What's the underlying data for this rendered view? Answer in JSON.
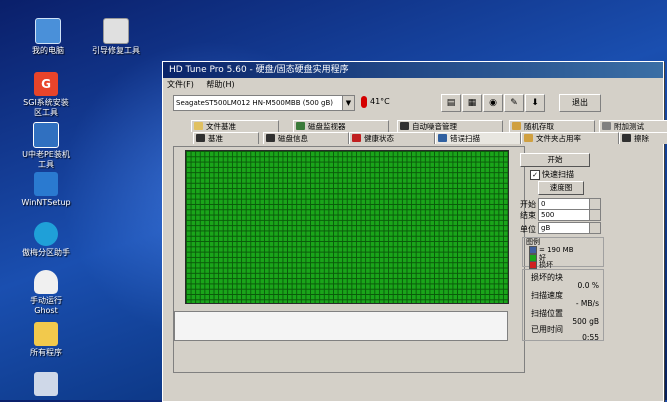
{
  "desktop": {
    "icons": [
      {
        "label": "我的电脑",
        "color": "#4a90d9"
      },
      {
        "label": "引导修复工具",
        "color": "#e0e0e0"
      },
      {
        "label": "SGI系统安装\n区工具",
        "color": "#e8442a"
      },
      {
        "label": "U中老PE装机\n工具",
        "color": "#3070c0"
      },
      {
        "label": "WinNTSetup",
        "color": "#2a7ad0"
      },
      {
        "label": "傲梅分区助手",
        "color": "#1fa0d8"
      },
      {
        "label": "手动运行\nGhost",
        "color": "#f0f0f0"
      },
      {
        "label": "所有程序",
        "color": "#f2c94c"
      }
    ]
  },
  "window": {
    "title": "HD Tune Pro 5.60 - 硬盘/固态硬盘实用程序",
    "menu": [
      "文件(F)",
      "帮助(H)"
    ],
    "drive": "SeagateST500LM012 HN-M500MBB (500 gB)",
    "temperature": "41°C",
    "exit_label": "退出",
    "tabs_row1": [
      {
        "label": "文件基准",
        "icon_color": "#e0c060"
      },
      {
        "label": "磁盘监视器",
        "icon_color": "#3a7a3a"
      },
      {
        "label": "自动噪音管理",
        "icon_color": "#303030"
      },
      {
        "label": "随机存取",
        "icon_color": "#d0a040"
      },
      {
        "label": "附加测试",
        "icon_color": "#808080"
      }
    ],
    "tabs_row2": [
      {
        "label": "基准",
        "icon_color": "#303030"
      },
      {
        "label": "磁盘信息",
        "icon_color": "#303030"
      },
      {
        "label": "健康状态",
        "icon_color": "#c02020"
      },
      {
        "label": "错误扫描",
        "icon_color": "#3060a0"
      },
      {
        "label": "文件夹占用率",
        "icon_color": "#d0a040"
      },
      {
        "label": "擦除",
        "icon_color": "#303030"
      }
    ]
  },
  "scan": {
    "start_button": "开始",
    "quick_scan_label": "快速扫描",
    "quick_scan_checked": "✓",
    "speed_map_button": "速度图",
    "start_label": "开始",
    "start_value": "0",
    "end_label": "结束",
    "end_value": "500",
    "unit_label": "单位",
    "unit_value": "gB",
    "legend_title": "图例",
    "legend": [
      {
        "label": "= 190 MB",
        "color": "#4060a0"
      },
      {
        "label": "好",
        "color": "#1aa51a"
      },
      {
        "label": "损坏",
        "color": "#d02020"
      }
    ],
    "damaged_label": "损坏的块",
    "damaged_value": "0.0 %",
    "speed_label": "扫描速度",
    "speed_value": "- MB/s",
    "position_label": "扫描位置",
    "position_value": "500 gB",
    "time_label": "已用时间",
    "time_value": "0:55"
  }
}
